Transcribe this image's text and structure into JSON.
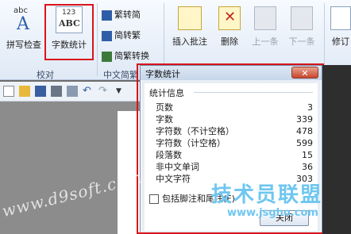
{
  "ribbon": {
    "spelling_label": "拼写检查",
    "wordcount_label": "字数统计",
    "wordcount_icon_text": "123",
    "wordcount_icon_sub": "ABC",
    "spelling_icon_text": "abc",
    "group_proofing": "校对",
    "group_chinese": "中文简繁",
    "trad_to_simp": "繁转简",
    "simp_to_trad": "简转繁",
    "convert": "简繁转换",
    "insert_comment": "插入批注",
    "delete": "删除",
    "prev": "上一条",
    "next": "下一条",
    "revise": "修订"
  },
  "dialog": {
    "title": "字数统计",
    "close_label": "关闭",
    "section": "统计信息",
    "stats": [
      {
        "label": "页数",
        "value": "3"
      },
      {
        "label": "字数",
        "value": "339"
      },
      {
        "label": "字符数（不计空格）",
        "value": "478"
      },
      {
        "label": "字符数（计空格）",
        "value": "599"
      },
      {
        "label": "段落数",
        "value": "15"
      },
      {
        "label": "非中文单词",
        "value": "36"
      },
      {
        "label": "中文字符",
        "value": "303"
      }
    ],
    "checkbox_label": "包括脚注和尾注(F)",
    "ok_label": "关闭"
  },
  "watermarks": {
    "left": "www.d9soft.com",
    "right_big": "技术员联盟",
    "right_small": "www.jsgho.com"
  },
  "colors": {
    "highlight": "#d8141b",
    "watermark": "#6fc6f0"
  }
}
